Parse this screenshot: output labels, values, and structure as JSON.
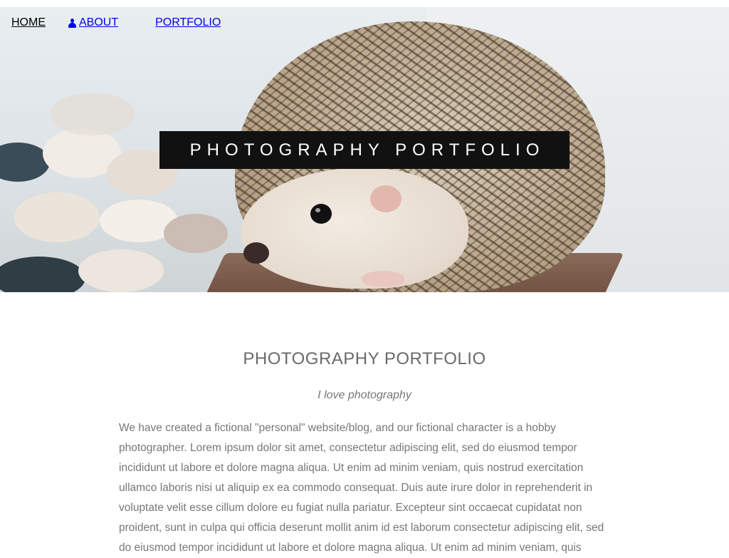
{
  "nav": {
    "items": [
      {
        "label": "HOME",
        "icon": ""
      },
      {
        "label": "ABOUT",
        "icon": "user-icon"
      },
      {
        "label": "PORTFOLIO",
        "icon": "grid-icon"
      }
    ]
  },
  "hero": {
    "banner_text": "PHOTOGRAPHY PORTFOLIO",
    "image_subject": "hedgehog"
  },
  "content": {
    "title": "PHOTOGRAPHY PORTFOLIO",
    "subtitle": "I love photography",
    "paragraph": "We have created a fictional \"personal\" website/blog, and our fictional character is a hobby photographer. Lorem ipsum dolor sit amet, consectetur adipiscing elit, sed do eiusmod tempor incididunt ut labore et dolore magna aliqua. Ut enim ad minim veniam, quis nostrud exercitation ullamco laboris nisi ut aliquip ex ea commodo consequat. Duis aute irure dolor in reprehenderit in voluptate velit esse cillum dolore eu fugiat nulla pariatur. Excepteur sint occaecat cupidatat non proident, sunt in culpa qui officia deserunt mollit anim id est laborum consectetur adipiscing elit, sed do eiusmod tempor incididunt ut labore et dolore magna aliqua. Ut enim ad minim veniam, quis"
  },
  "colors": {
    "nav_link": "#0000ee",
    "nav_home": "#000000",
    "banner_bg": "#111111",
    "banner_text": "#ffffff",
    "body_text": "#777777"
  }
}
